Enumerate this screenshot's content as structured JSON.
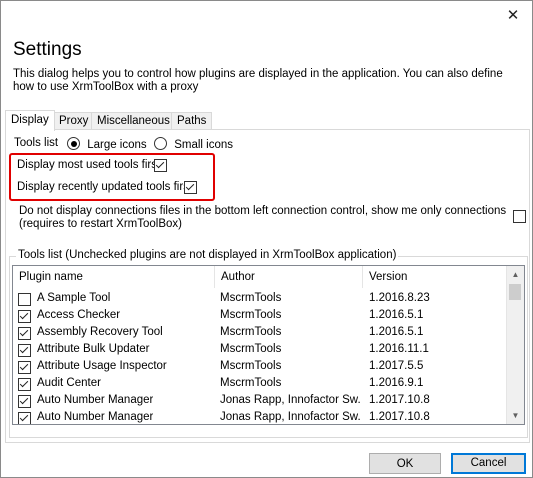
{
  "window": {
    "close_glyph": "✕"
  },
  "header": {
    "title": "Settings",
    "description": "This dialog helps you to control how plugins are displayed in the application. You can also define how to use XrmToolBox with a proxy"
  },
  "tabs": [
    {
      "label": "Display",
      "active": true
    },
    {
      "label": "Proxy",
      "active": false
    },
    {
      "label": "Miscellaneous",
      "active": false
    },
    {
      "label": "Paths",
      "active": false
    }
  ],
  "display": {
    "tools_list_label": "Tools list",
    "large_icons_label": "Large icons",
    "large_icons_selected": true,
    "small_icons_label": "Small icons",
    "small_icons_selected": false,
    "most_used_label": "Display most used tools first",
    "most_used_checked": true,
    "recently_updated_label": "Display recently updated tools first",
    "recently_updated_checked": true,
    "connections_label": "Do not display connections files in the bottom left connection control, show me only connections (requires to restart XrmToolBox)",
    "connections_checked": false,
    "highlight_color": "#e00000"
  },
  "plugins_group": {
    "legend": "Tools list (Unchecked plugins are not displayed in XrmToolBox application)",
    "columns": [
      "Plugin name",
      "Author",
      "Version"
    ],
    "rows": [
      {
        "checked": false,
        "name": "A Sample Tool",
        "author": "MscrmTools",
        "version": "1.2016.8.23"
      },
      {
        "checked": true,
        "name": "Access Checker",
        "author": "MscrmTools",
        "version": "1.2016.5.1"
      },
      {
        "checked": true,
        "name": "Assembly Recovery Tool",
        "author": "MscrmTools",
        "version": "1.2016.5.1"
      },
      {
        "checked": true,
        "name": "Attribute Bulk Updater",
        "author": "MscrmTools",
        "version": "1.2016.11.1"
      },
      {
        "checked": true,
        "name": "Attribute Usage Inspector",
        "author": "MscrmTools",
        "version": "1.2017.5.5"
      },
      {
        "checked": true,
        "name": "Audit Center",
        "author": "MscrmTools",
        "version": "1.2016.9.1"
      },
      {
        "checked": true,
        "name": "Auto Number Manager",
        "author": "Jonas Rapp, Innofactor Sw...",
        "version": "1.2017.10.8"
      },
      {
        "checked": true,
        "name": "Auto Number Manager",
        "author": "Jonas Rapp, Innofactor Sw...",
        "version": "1.2017.10.8"
      }
    ]
  },
  "footer": {
    "ok_label": "OK",
    "cancel_label": "Cancel",
    "accent_color": "#0078d7"
  }
}
